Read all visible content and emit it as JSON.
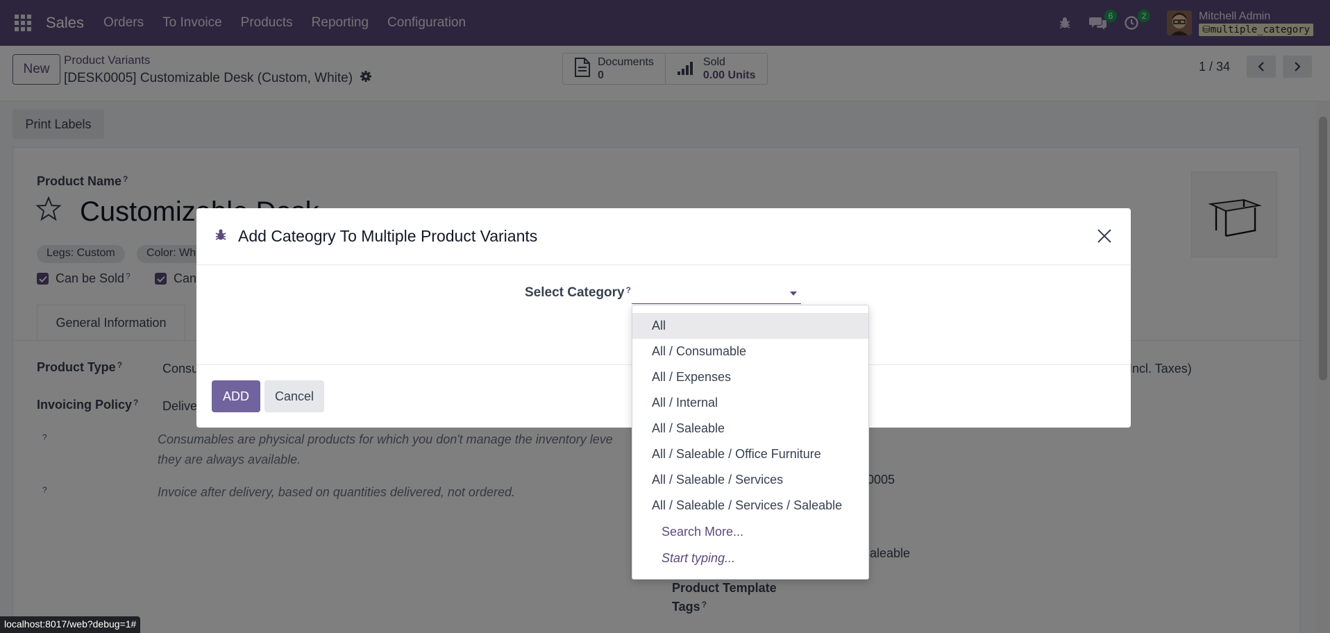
{
  "navbar": {
    "app_name": "Sales",
    "menu": [
      "Orders",
      "To Invoice",
      "Products",
      "Reporting",
      "Configuration"
    ],
    "messages_count": "6",
    "activities_count": "2",
    "user_name": "Mitchell Admin",
    "database": "multiple_category",
    "color": "#5b4a7b"
  },
  "control": {
    "new_label": "New",
    "breadcrumb_parent": "Product Variants",
    "breadcrumb_current": "[DESK0005] Customizable Desk (Custom, White)",
    "documents_label": "Documents",
    "documents_value": "0",
    "sold_label": "Sold",
    "sold_value": "0.00 Units",
    "pager_value": "1 / 34"
  },
  "form": {
    "print_labels": "Print Labels",
    "product_name_label": "Product Name",
    "help_mark": "?",
    "product_name": "Customizable Desk",
    "tags": [
      "Legs: Custom",
      "Color: Wh"
    ],
    "can_be_sold": "Can be Sold",
    "can_be_purchased": "Can",
    "tab_general": "General Information",
    "product_type_label": "Product Type",
    "product_type_value": "Consu",
    "invoicing_policy_label": "Invoicing Policy",
    "invoicing_policy_value": "Delive",
    "help_consumables_1": "Consumables are physical products for which you don't manage the inventory leve",
    "help_consumables_2": "they are always available.",
    "help_invoice": "Invoice after delivery, based on quantities delivered, not ordered.",
    "right_price_fragment": "Incl. Taxes)",
    "right_ref_fragment": "0005",
    "right_category_fragment": "aleable",
    "product_template_label": "Product Template",
    "tags_label": "Tags"
  },
  "modal": {
    "title": "Add Cateogry To Multiple Product Variants",
    "select_category_label": "Select Category",
    "select_category_value": "",
    "add_label": "ADD",
    "cancel_label": "Cancel"
  },
  "dropdown": {
    "options": [
      "All",
      "All / Consumable",
      "All / Expenses",
      "All / Internal",
      "All / Saleable",
      "All / Saleable / Office Furniture",
      "All / Saleable / Services",
      "All / Saleable / Services / Saleable"
    ],
    "highlighted": "All",
    "search_more": "Search More...",
    "start_typing": "Start typing..."
  },
  "status_bar": {
    "url": "localhost:8017/web?debug=1#"
  }
}
